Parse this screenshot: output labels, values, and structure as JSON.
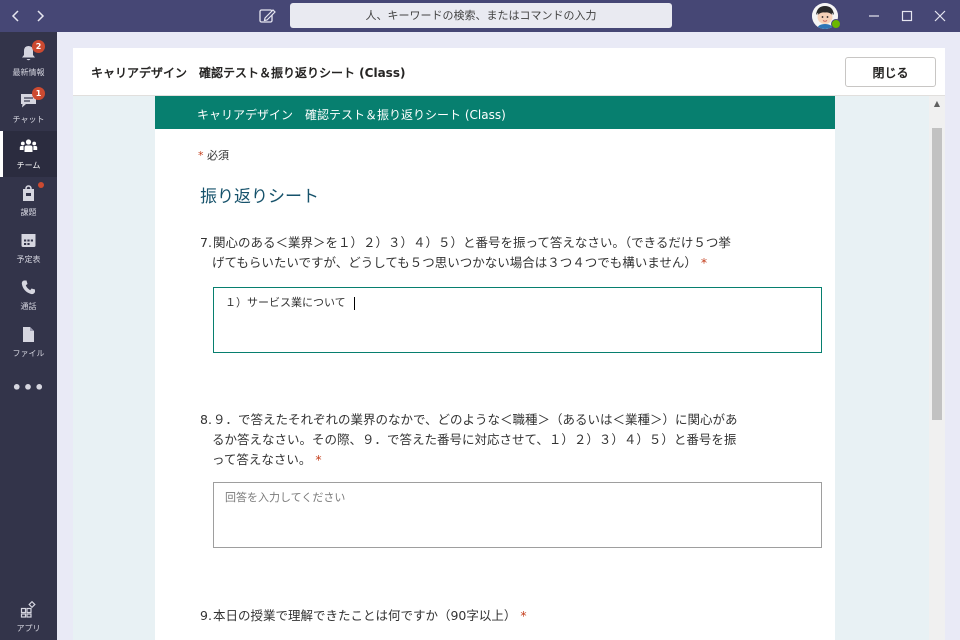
{
  "titlebar": {
    "search_placeholder": "人、キーワードの検索、またはコマンドの入力",
    "back_icon": "chevron-left-icon",
    "forward_icon": "chevron-right-icon",
    "compose_icon": "compose-icon",
    "window_controls": [
      "minimize-icon",
      "maximize-icon",
      "close-icon"
    ]
  },
  "rail": {
    "items": [
      {
        "label": "最新情報",
        "icon": "bell-icon",
        "badge": "2"
      },
      {
        "label": "チャット",
        "icon": "chat-icon",
        "badge": "1"
      },
      {
        "label": "チーム",
        "icon": "teams-icon",
        "active": true
      },
      {
        "label": "課題",
        "icon": "assignments-icon",
        "dot": true
      },
      {
        "label": "予定表",
        "icon": "calendar-icon"
      },
      {
        "label": "通話",
        "icon": "phone-icon"
      },
      {
        "label": "ファイル",
        "icon": "file-icon"
      }
    ],
    "more": "•••",
    "apps_label": "アプリ"
  },
  "dialog": {
    "title": "キャリアデザイン　確認テスト＆振り返りシート (Class)",
    "close_label": "閉じる"
  },
  "form": {
    "banner_title": "キャリアデザイン　確認テスト＆振り返りシート (Class)",
    "required_star": "*",
    "required_label": "必須",
    "section_title": "振り返りシート",
    "questions": [
      {
        "number": "7.",
        "text_line1": "関心のある＜業界＞を１）２）３）４）５）と番号を振って答えなさい。（できるだけ５つ挙",
        "text_line2": "げてもらいたいですが、どうしても５つ思いつかない場合は３つ４つでも構いません）",
        "star": "*",
        "answer_value": "１）サービス業について",
        "answer_placeholder": ""
      },
      {
        "number": "8.",
        "text_line1": "９．で答えたそれぞれの業界のなかで、どのような＜職種＞（あるいは＜業種＞）に関心があ",
        "text_line2": "るか答えなさい。その際、９．で答えた番号に対応させて、１）２）３）４）５）と番号を振",
        "text_line3": "って答えなさい。",
        "star": "*",
        "answer_value": "",
        "answer_placeholder": "回答を入力してください"
      },
      {
        "number": "9.",
        "text_line1": "本日の授業で理解できたことは何ですか（90字以上）",
        "star": "*"
      }
    ]
  },
  "colors": {
    "titlebar": "#464775",
    "rail": "#33344a",
    "banner": "#077f6f",
    "section_title": "#16526b",
    "required": "#c43e1c",
    "badge": "#cc4a31"
  }
}
